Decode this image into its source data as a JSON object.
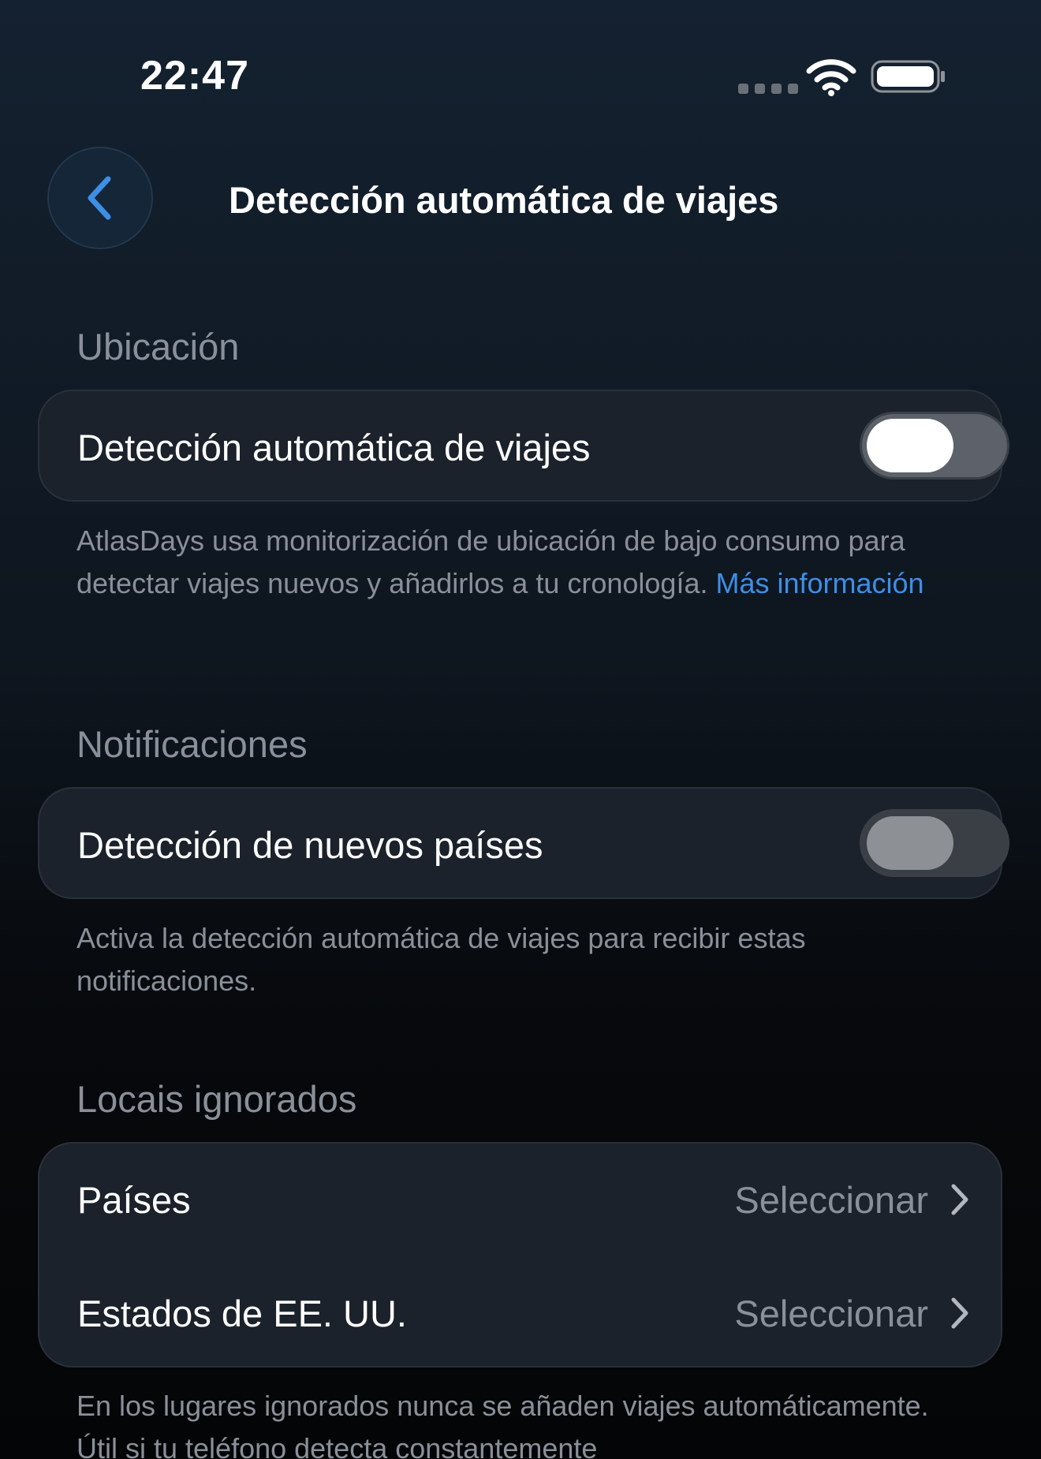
{
  "status_bar": {
    "time": "22:47"
  },
  "nav": {
    "title": "Detección automática de viajes",
    "back_icon": "chevron-left-icon"
  },
  "location_section": {
    "label": "Ubicación",
    "toggle_label": "Detección automática de viajes",
    "toggle_state": "off",
    "footnote_text": "AtlasDays usa monitorización de ubicación de bajo consumo para detectar viajes nuevos y añadirlos a tu cronología. ",
    "footnote_link": "Más información"
  },
  "notifications_section": {
    "label": "Notificaciones",
    "toggle_label": "Detección de nuevos países",
    "toggle_state": "off-disabled",
    "footnote_text": "Activa la detección automática de viajes para recibir estas notificaciones."
  },
  "ignored_section": {
    "label": "Locais ignorados",
    "rows": [
      {
        "label": "Países",
        "value": "Seleccionar"
      },
      {
        "label": "Estados de EE. UU.",
        "value": "Seleccionar"
      }
    ],
    "footnote_text": "En los lugares ignorados nunca se añaden viajes automáticamente. Útil si tu teléfono detecta constantemente"
  },
  "colors": {
    "accent": "#3f8ee6",
    "background_top": "#142130",
    "card": "#1c222b",
    "secondary_text": "#8a9099"
  }
}
